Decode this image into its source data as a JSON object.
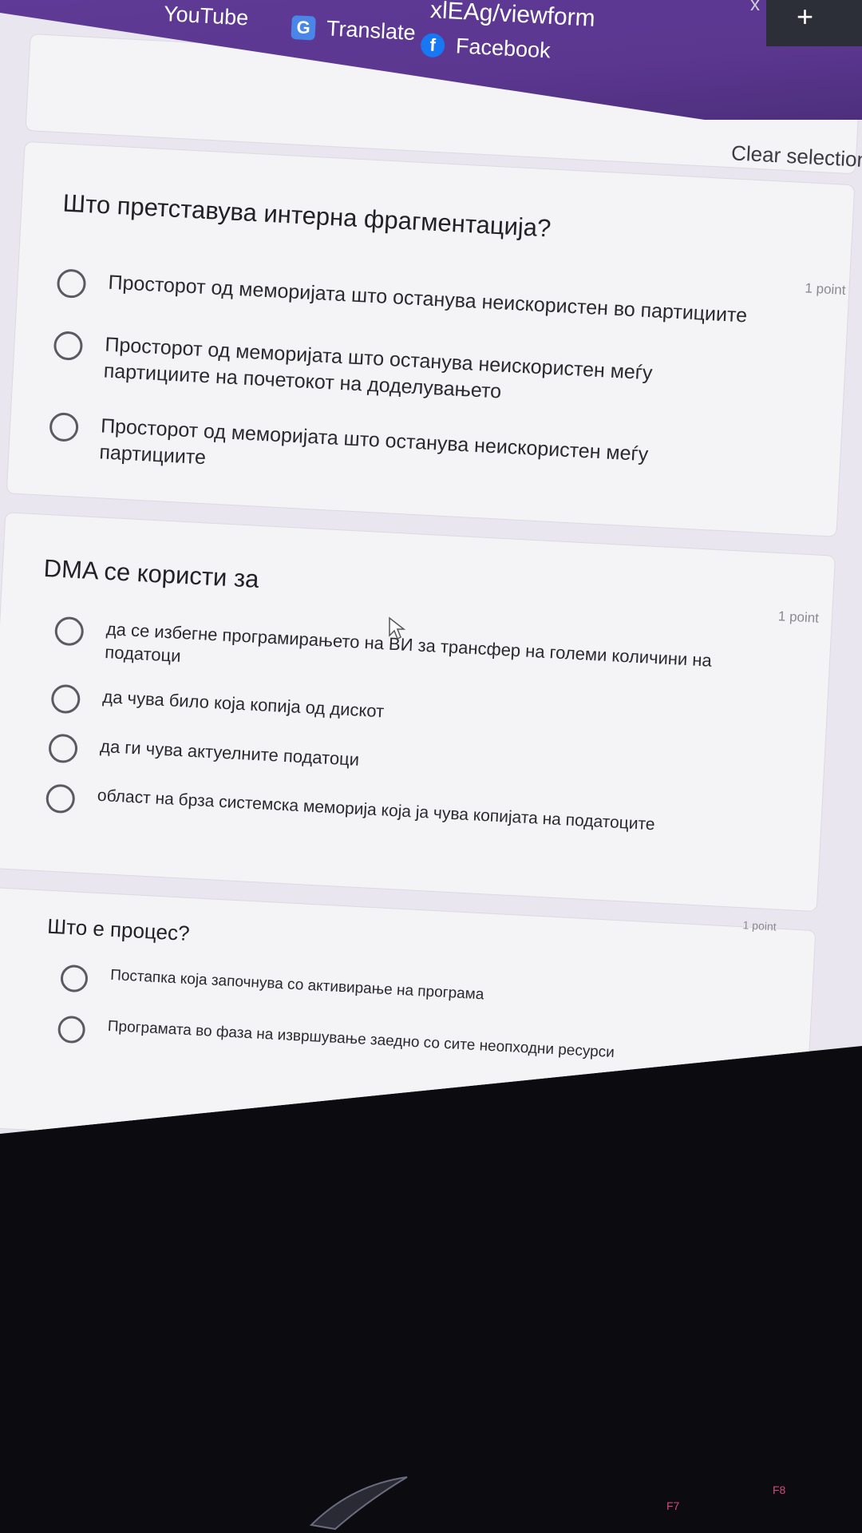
{
  "browser": {
    "url_fragment": "xlEAg/viewform",
    "bookmarks": [
      {
        "label": "YouTube",
        "icon": "youtube-icon"
      },
      {
        "label": "Translate",
        "icon": "google-translate-icon"
      },
      {
        "label": "Facebook",
        "icon": "facebook-icon"
      }
    ],
    "new_tab_glyph": "+",
    "close_tab_glyph": "x",
    "colors": {
      "bookmark_bar": "#5b3790"
    }
  },
  "form": {
    "clear_selection": "Clear selection",
    "questions": [
      {
        "title": "Што претставува интерна фрагментација?",
        "points": "1 point",
        "options": [
          "Просторот од меморијата што останува неискористен во партициите",
          "Просторот од меморијата што останува неискористен меѓу партициите на почетокот на доделувањето",
          "Просторот од меморијата што останува неискористен меѓу партициите"
        ]
      },
      {
        "title": "DMA се користи за",
        "points": "1 point",
        "options": [
          "да се избегне програмирањето на ВИ за трансфер на големи количини на податоци",
          "да чува било која копија од дискот",
          "да ги чува актуелните податоци",
          "област на брза системска меморија која ја чува копијата на податоците"
        ]
      },
      {
        "title": "Што е процес?",
        "points": "1 point",
        "options": [
          "Постапка која започнува со активирање на програма",
          "Програмата во фаза на извршување заедно со сите неопходни ресурси"
        ]
      }
    ]
  },
  "keyboard": {
    "keys": [
      "F7",
      "F8"
    ]
  }
}
